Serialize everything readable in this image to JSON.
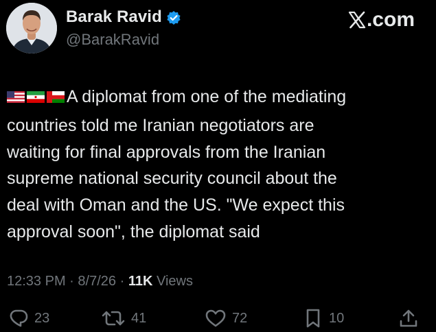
{
  "author": {
    "display_name": "Barak Ravid",
    "handle": "@BarakRavid",
    "verified": true
  },
  "brand": {
    "label": ".com",
    "logo_icon": "x-logo-icon"
  },
  "tweet": {
    "flags": [
      "us-flag-icon",
      "iran-flag-icon",
      "oman-flag-icon"
    ],
    "text": "A diplomat from one of the mediating\ncountries told me Iranian negotiators are\nwaiting for final approvals from the Iranian\nsupreme national security council about the\ndeal with Oman and the US. \"We expect this\napproval soon\", the diplomat said"
  },
  "meta": {
    "time": "12:33 PM",
    "date": "8/7/26",
    "separator": "·",
    "views_count": "11K",
    "views_label": "Views"
  },
  "actions": {
    "replies": "23",
    "reposts": "41",
    "likes": "72",
    "bookmarks": "10"
  },
  "colors": {
    "background": "#000000",
    "primary_text": "#e7e9ea",
    "secondary_text": "#71767b",
    "verified_badge": "#1d9bf0"
  }
}
